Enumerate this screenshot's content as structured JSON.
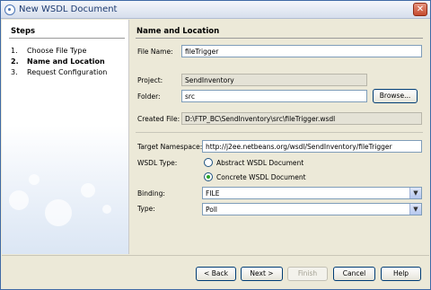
{
  "window": {
    "title": "New WSDL Document"
  },
  "steps": {
    "heading": "Steps",
    "items": [
      {
        "num": "1.",
        "label": "Choose File Type"
      },
      {
        "num": "2.",
        "label": "Name and Location"
      },
      {
        "num": "3.",
        "label": "Request Configuration"
      }
    ]
  },
  "panel": {
    "heading": "Name and Location",
    "file_name_label": "File Name:",
    "file_name_value": "fileTrigger",
    "project_label": "Project:",
    "project_value": "SendInventory",
    "folder_label": "Folder:",
    "folder_value": "src",
    "browse_label": "Browse...",
    "created_file_label": "Created File:",
    "created_file_value": "D:\\FTP_BC\\SendInventory\\src\\fileTrigger.wsdl",
    "target_ns_label": "Target Namespace:",
    "target_ns_value": "http://j2ee.netbeans.org/wsdl/SendInventory/fileTrigger",
    "wsdl_type_label": "WSDL Type:",
    "wsdl_type_options": [
      "Abstract WSDL Document",
      "Concrete WSDL Document"
    ],
    "wsdl_type_selected": "Concrete WSDL Document",
    "binding_label": "Binding:",
    "binding_value": "FILE",
    "type_label": "Type:",
    "type_value": "Poll"
  },
  "buttons": {
    "back": "< Back",
    "next": "Next >",
    "finish": "Finish",
    "cancel": "Cancel",
    "help": "Help"
  }
}
